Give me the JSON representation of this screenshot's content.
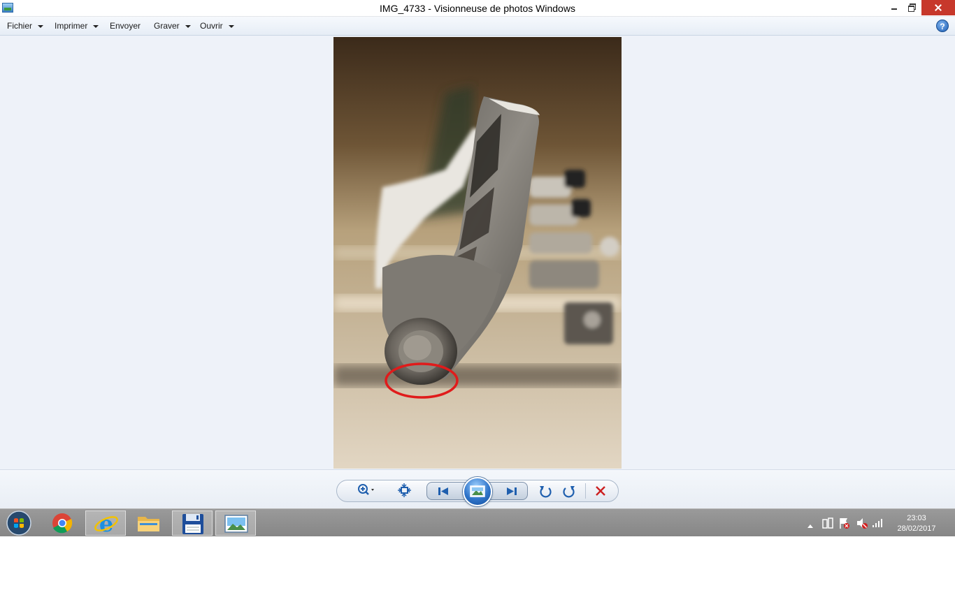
{
  "window": {
    "title": "IMG_4733 - Visionneuse de photos Windows",
    "icon": "photo-viewer-icon"
  },
  "menu": {
    "items": [
      {
        "label": "Fichier",
        "has_dropdown": true
      },
      {
        "label": "Imprimer",
        "has_dropdown": true
      },
      {
        "label": "Envoyer",
        "has_dropdown": false
      },
      {
        "label": "Graver",
        "has_dropdown": true
      },
      {
        "label": "Ouvrir",
        "has_dropdown": true
      }
    ],
    "help_label": "?"
  },
  "controls": {
    "buttons": [
      "zoom-icon",
      "fit-to-window-icon",
      "previous-icon",
      "slideshow-icon",
      "next-icon",
      "rotate-counterclockwise-icon",
      "rotate-clockwise-icon",
      "delete-icon"
    ]
  },
  "taskbar": {
    "apps": [
      "start-button",
      "chrome-icon",
      "internet-explorer-icon",
      "file-explorer-icon",
      "save-disk-icon",
      "photo-viewer-icon"
    ],
    "active_app": "photo-viewer-icon",
    "tray": [
      "show-hidden-icons",
      "usb-icon",
      "action-center-icon",
      "speaker-muted-icon",
      "signal-icon"
    ],
    "time": "23:03",
    "date": "28/02/2017"
  },
  "colors": {
    "close_button": "#c7382b",
    "annotation_circle": "#e01b1b",
    "viewer_background": "#eef2f9",
    "taskbar": "#8e8e8e"
  }
}
